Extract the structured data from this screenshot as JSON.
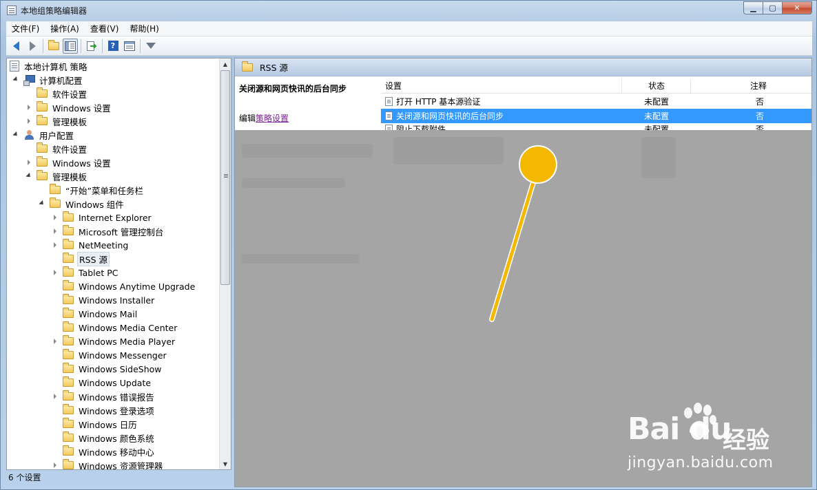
{
  "window": {
    "title": "本地组策略编辑器",
    "min_label": "▁",
    "max_label": "▢",
    "close_label": "✕"
  },
  "menu": [
    {
      "label": "文件(F)"
    },
    {
      "label": "操作(A)"
    },
    {
      "label": "查看(V)"
    },
    {
      "label": "帮助(H)"
    }
  ],
  "tree": {
    "items": [
      {
        "label": "本地计算机 策略"
      },
      {
        "label": "计算机配置"
      },
      {
        "label": "软件设置"
      },
      {
        "label": "Windows 设置"
      },
      {
        "label": "管理模板"
      },
      {
        "label": "用户配置"
      },
      {
        "label": "软件设置"
      },
      {
        "label": "Windows 设置"
      },
      {
        "label": "管理模板"
      },
      {
        "label": "“开始”菜单和任务栏"
      },
      {
        "label": "Windows 组件"
      },
      {
        "label": "Internet Explorer"
      },
      {
        "label": "Microsoft 管理控制台"
      },
      {
        "label": "NetMeeting"
      },
      {
        "label": "RSS 源"
      },
      {
        "label": "Tablet PC"
      },
      {
        "label": "Windows Anytime Upgrade"
      },
      {
        "label": "Windows Installer"
      },
      {
        "label": "Windows Mail"
      },
      {
        "label": "Windows Media Center"
      },
      {
        "label": "Windows Media Player"
      },
      {
        "label": "Windows Messenger"
      },
      {
        "label": "Windows SideShow"
      },
      {
        "label": "Windows Update"
      },
      {
        "label": "Windows 错误报告"
      },
      {
        "label": "Windows 登录选项"
      },
      {
        "label": "Windows 日历"
      },
      {
        "label": "Windows 颜色系统"
      },
      {
        "label": "Windows 移动中心"
      },
      {
        "label": "Windows 资源管理器"
      }
    ]
  },
  "status": {
    "text": "6 个设置"
  },
  "right": {
    "header": "RSS 源",
    "desc_title": "关闭源和网页快讯的后台同步",
    "desc_edit_prefix": "编辑",
    "desc_edit_link": "策略设置",
    "columns": {
      "setting": "设置",
      "state": "状态",
      "note": "注释"
    },
    "rows": [
      {
        "name": "打开 HTTP 基本源验证",
        "state": "未配置",
        "note": "否"
      },
      {
        "name": "关闭源和网页快讯的后台同步",
        "state": "未配置",
        "note": "否"
      },
      {
        "name": "阻止下载附件",
        "state": "未配置",
        "note": "否"
      }
    ]
  },
  "watermark": {
    "logo": "Bai  du",
    "cn": "经验",
    "url": "jingyan.baidu.com"
  },
  "colors": {
    "selection": "#3399ff",
    "pin": "#f5b800",
    "blur": "#a5a5a5"
  }
}
